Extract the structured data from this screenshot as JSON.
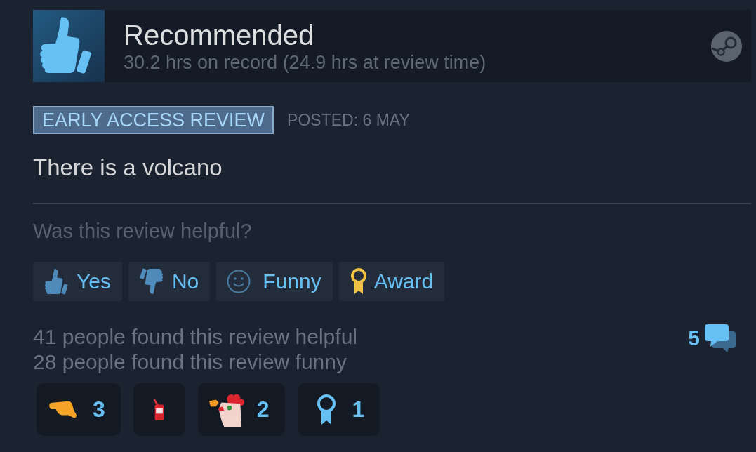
{
  "review": {
    "recommended": true,
    "verdict": "Recommended",
    "playtime": "30.2 hrs on record (24.9 hrs at review time)",
    "badge": "EARLY ACCESS REVIEW",
    "posted": "POSTED: 6 MAY",
    "body": "There is a volcano"
  },
  "feedback": {
    "question": "Was this review helpful?",
    "buttons": [
      {
        "kind": "yes",
        "label": "Yes"
      },
      {
        "kind": "no",
        "label": "No"
      },
      {
        "kind": "funny",
        "label": "Funny"
      },
      {
        "kind": "award",
        "label": "Award"
      }
    ],
    "stats": [
      "41 people found this review helpful",
      "28 people found this review funny"
    ],
    "comment_count": "5"
  },
  "awards": [
    {
      "kind": "hand",
      "count": "3"
    },
    {
      "kind": "bottle"
    },
    {
      "kind": "chicken",
      "count": "2"
    },
    {
      "kind": "ribbon",
      "count": "1"
    }
  ]
}
